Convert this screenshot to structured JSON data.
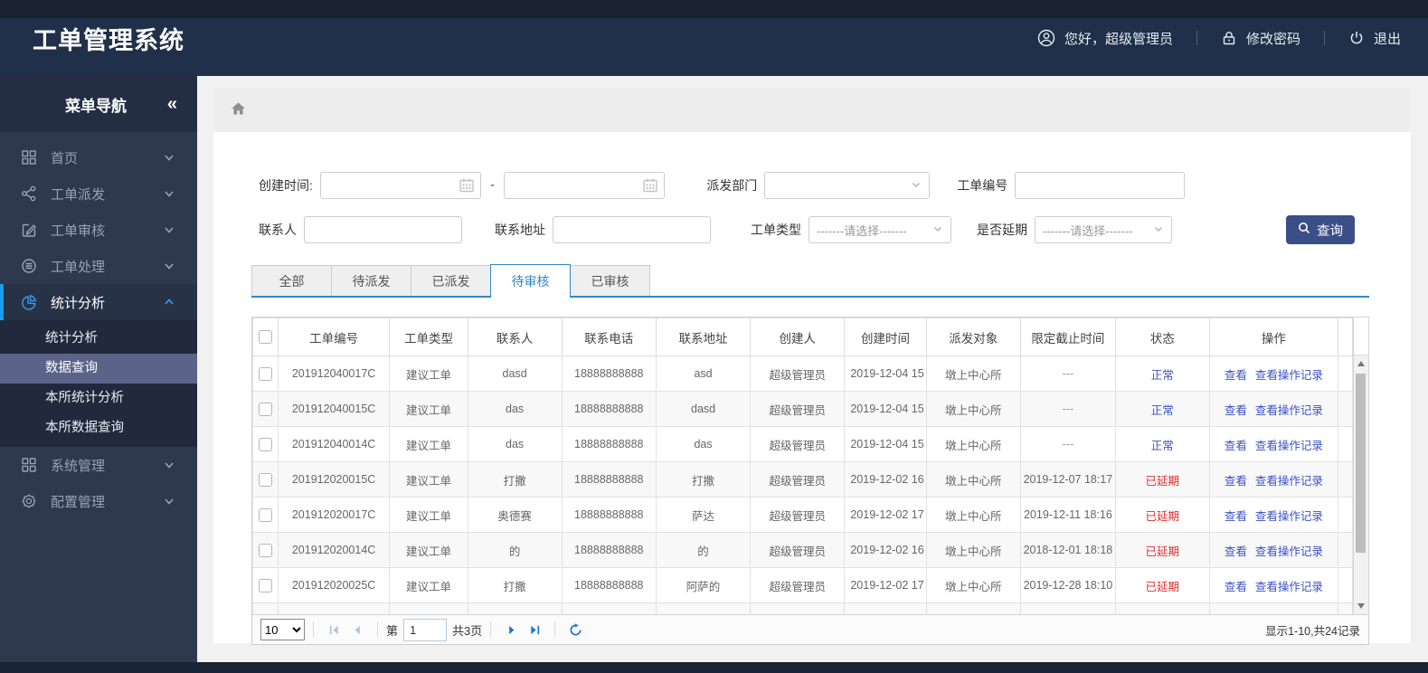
{
  "header": {
    "title": "工单管理系统",
    "greeting": "您好，超级管理员",
    "change_password": "修改密码",
    "logout": "退出"
  },
  "sidebar": {
    "title": "菜单导航",
    "collapse_icon": "«",
    "items": [
      {
        "label": "首页",
        "icon": "dashboard-icon",
        "active": false
      },
      {
        "label": "工单派发",
        "icon": "share-icon",
        "active": false
      },
      {
        "label": "工单审核",
        "icon": "edit-icon",
        "active": false
      },
      {
        "label": "工单处理",
        "icon": "process-icon",
        "active": false
      },
      {
        "label": "统计分析",
        "icon": "pie-chart-icon",
        "active": true,
        "children": [
          "统计分析",
          "数据查询",
          "本所统计分析",
          "本所数据查询"
        ],
        "selected_child": "数据查询"
      },
      {
        "label": "系统管理",
        "icon": "system-icon",
        "active": false
      },
      {
        "label": "配置管理",
        "icon": "gear-icon",
        "active": false
      }
    ]
  },
  "filters": {
    "create_time_label": "创建时间:",
    "create_time_from": "",
    "create_time_to": "",
    "range_separator": "-",
    "dispatch_dept_label": "派发部门",
    "dispatch_dept_value": "",
    "order_no_label": "工单编号",
    "order_no_value": "",
    "contact_label": "联系人",
    "contact_value": "",
    "address_label": "联系地址",
    "address_value": "",
    "order_type_label": "工单类型",
    "order_type_value": "-------请选择-------",
    "delay_label": "是否延期",
    "delay_value": "-------请选择-------",
    "search_button": "查询"
  },
  "tabs": {
    "items": [
      {
        "label": "全部",
        "active": false
      },
      {
        "label": "待派发",
        "active": false
      },
      {
        "label": "已派发",
        "active": false
      },
      {
        "label": "待审核",
        "active": true
      },
      {
        "label": "已审核",
        "active": false
      }
    ]
  },
  "table": {
    "columns": [
      "工单编号",
      "工单类型",
      "联系人",
      "联系电话",
      "联系地址",
      "创建人",
      "创建时间",
      "派发对象",
      "限定截止时间",
      "状态",
      "操作"
    ],
    "action_view": "查看",
    "action_log": "查看操作记录",
    "rows": [
      {
        "order_no": "201912040017C",
        "type": "建议工单",
        "contact": "dasd",
        "phone": "18888888888",
        "address": "asd",
        "creator": "超级管理员",
        "created": "2019-12-04 15",
        "target": "墩上中心所",
        "deadline": "---",
        "status": "正常",
        "status_color": "blue"
      },
      {
        "order_no": "201912040015C",
        "type": "建议工单",
        "contact": "das",
        "phone": "18888888888",
        "address": "dasd",
        "creator": "超级管理员",
        "created": "2019-12-04 15",
        "target": "墩上中心所",
        "deadline": "---",
        "status": "正常",
        "status_color": "blue"
      },
      {
        "order_no": "201912040014C",
        "type": "建议工单",
        "contact": "das",
        "phone": "18888888888",
        "address": "das",
        "creator": "超级管理员",
        "created": "2019-12-04 15",
        "target": "墩上中心所",
        "deadline": "---",
        "status": "正常",
        "status_color": "blue"
      },
      {
        "order_no": "201912020015C",
        "type": "建议工单",
        "contact": "打撒",
        "phone": "18888888888",
        "address": "打撒",
        "creator": "超级管理员",
        "created": "2019-12-02 16",
        "target": "墩上中心所",
        "deadline": "2019-12-07 18:17",
        "status": "已延期",
        "status_color": "red"
      },
      {
        "order_no": "201912020017C",
        "type": "建议工单",
        "contact": "奥德赛",
        "phone": "18888888888",
        "address": "萨达",
        "creator": "超级管理员",
        "created": "2019-12-02 17",
        "target": "墩上中心所",
        "deadline": "2019-12-11 18:16",
        "status": "已延期",
        "status_color": "red"
      },
      {
        "order_no": "201912020014C",
        "type": "建议工单",
        "contact": "的",
        "phone": "18888888888",
        "address": "的",
        "creator": "超级管理员",
        "created": "2019-12-02 16",
        "target": "墩上中心所",
        "deadline": "2018-12-01 18:18",
        "status": "已延期",
        "status_color": "red"
      },
      {
        "order_no": "201912020025C",
        "type": "建议工单",
        "contact": "打撒",
        "phone": "18888888888",
        "address": "阿萨的",
        "creator": "超级管理员",
        "created": "2019-12-02 17",
        "target": "墩上中心所",
        "deadline": "2019-12-28 18:10",
        "status": "已延期",
        "status_color": "red"
      }
    ]
  },
  "pagination": {
    "page_size": "10",
    "page_prefix": "第",
    "current_page": "1",
    "total_pages": "共3页",
    "summary": "显示1-10,共24记录"
  },
  "colors": {
    "accent_blue": "#3287c8",
    "link_blue": "#3c51c6",
    "status_delayed_red": "#e12e2e",
    "search_button_bg": "#3c4e87",
    "header_navy": "#20304a",
    "sidebar_dark": "#2e3950",
    "submenu_selected": "#5b6488"
  }
}
